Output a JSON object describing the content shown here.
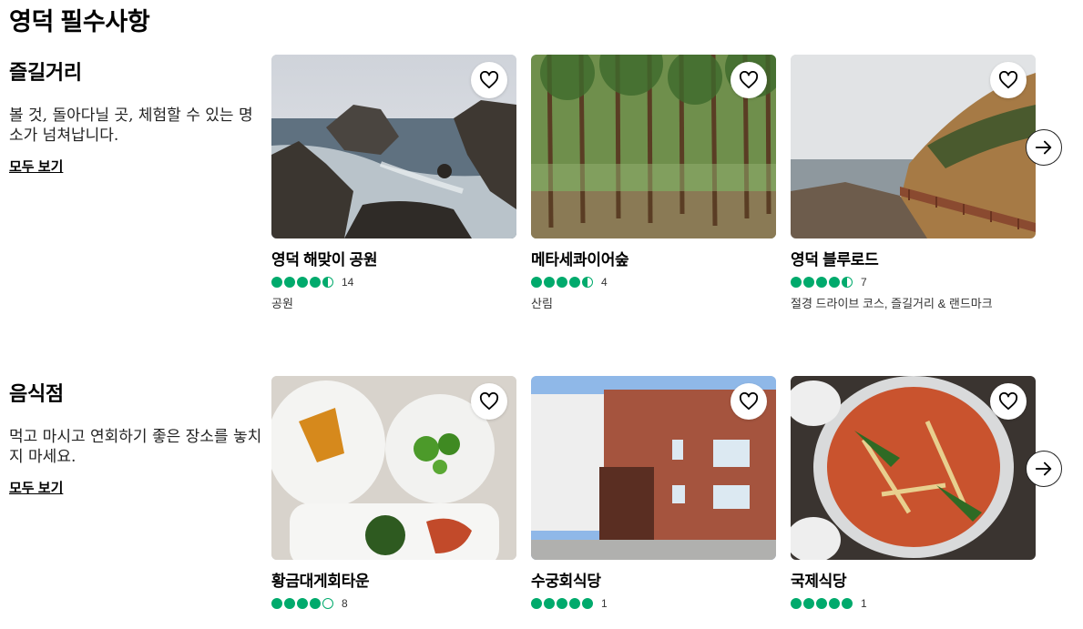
{
  "page": {
    "title": "영덕 필수사항"
  },
  "sections": [
    {
      "title": "즐길거리",
      "description": "볼 것, 돌아다닐 곳, 체험할 수 있는 명소가 넘쳐납니다.",
      "see_all": "모두 보기",
      "cards": [
        {
          "name": "영덕 해맞이 공원",
          "rating": 4.5,
          "reviews": "14",
          "category": "공원",
          "icon": "heart-icon"
        },
        {
          "name": "메타세콰이어숲",
          "rating": 4.5,
          "reviews": "4",
          "category": "산림",
          "icon": "heart-icon"
        },
        {
          "name": "영덕 블루로드",
          "rating": 4.5,
          "reviews": "7",
          "category": "절경 드라이브 코스, 즐길거리 & 랜드마크",
          "icon": "heart-icon"
        }
      ],
      "next_icon": "arrow-right-icon"
    },
    {
      "title": "음식점",
      "description": "먹고 마시고 연회하기 좋은 장소를 놓치지 마세요.",
      "see_all": "모두 보기",
      "cards": [
        {
          "name": "황금대게회타운",
          "rating": 4,
          "reviews": "8",
          "category": "",
          "icon": "heart-icon"
        },
        {
          "name": "수궁회식당",
          "rating": 5,
          "reviews": "1",
          "category": "",
          "icon": "heart-icon"
        },
        {
          "name": "국제식당",
          "rating": 5,
          "reviews": "1",
          "category": "",
          "icon": "heart-icon"
        }
      ],
      "next_icon": "arrow-right-icon"
    }
  ],
  "colors": {
    "rating_green": "#00aa6c",
    "text": "#000000"
  }
}
